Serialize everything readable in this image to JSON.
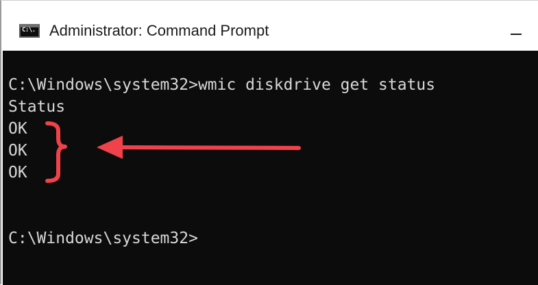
{
  "window": {
    "title": "Administrator: Command Prompt",
    "icon_glyph": "C:\\.",
    "icon": "console-icon",
    "minimize": "minimize-icon"
  },
  "console": {
    "lines": [
      "",
      "C:\\Windows\\system32>wmic diskdrive get status",
      "Status",
      "OK",
      "OK",
      "OK",
      "",
      "",
      "C:\\Windows\\system32>"
    ],
    "text_color": "#d8d8d8",
    "background": "#0c0c0c"
  },
  "annotation": {
    "color": "#f0424a",
    "shapes": [
      "curly-brace-icon",
      "arrow-left-icon"
    ]
  }
}
